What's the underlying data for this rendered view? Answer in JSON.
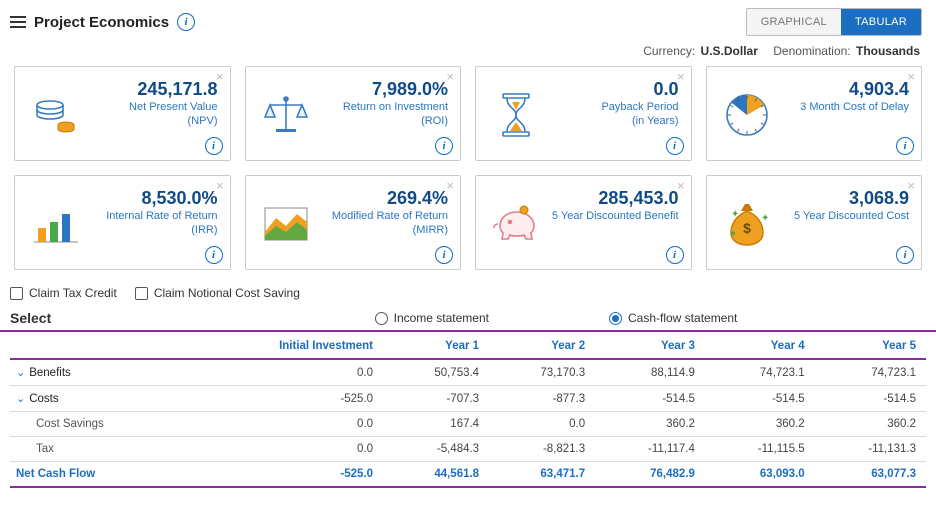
{
  "header": {
    "title": "Project Economics",
    "toggle": {
      "graphical": "GRAPHICAL",
      "tabular": "TABULAR"
    }
  },
  "meta": {
    "currency_label": "Currency:",
    "currency_value": "U.S.Dollar",
    "denomination_label": "Denomination:",
    "denomination_value": "Thousands"
  },
  "cards": [
    {
      "value": "245,171.8",
      "label": "Net Present Value\n(NPV)",
      "icon": "coins-icon"
    },
    {
      "value": "7,989.0%",
      "label": "Return on Investment\n(ROI)",
      "icon": "scales-icon"
    },
    {
      "value": "0.0",
      "label": "Payback Period\n(in Years)",
      "icon": "hourglass-icon"
    },
    {
      "value": "4,903.4",
      "label": "3 Month Cost of Delay",
      "icon": "clock-icon"
    },
    {
      "value": "8,530.0%",
      "label": "Internal Rate of Return\n(IRR)",
      "icon": "bar-chart-icon"
    },
    {
      "value": "269.4%",
      "label": "Modified Rate of Return\n(MIRR)",
      "icon": "area-chart-icon"
    },
    {
      "value": "285,453.0",
      "label": "5 Year Discounted Benefit",
      "icon": "piggy-icon"
    },
    {
      "value": "3,068.9",
      "label": "5 Year Discounted Cost",
      "icon": "money-bag-icon"
    }
  ],
  "options": {
    "claim_tax": "Claim Tax Credit",
    "claim_notional": "Claim Notional Cost Saving"
  },
  "statement": {
    "select_label": "Select",
    "income": "Income statement",
    "cashflow": "Cash-flow statement"
  },
  "table": {
    "headers": [
      "",
      "Initial Investment",
      "Year 1",
      "Year 2",
      "Year 3",
      "Year 4",
      "Year 5"
    ],
    "rows": [
      {
        "kind": "head",
        "label": "Benefits",
        "cells": [
          "0.0",
          "50,753.4",
          "73,170.3",
          "88,114.9",
          "74,723.1",
          "74,723.1"
        ]
      },
      {
        "kind": "head",
        "label": "Costs",
        "cells": [
          "-525.0",
          "-707.3",
          "-877.3",
          "-514.5",
          "-514.5",
          "-514.5"
        ]
      },
      {
        "kind": "sub",
        "label": "Cost Savings",
        "cells": [
          "0.0",
          "167.4",
          "0.0",
          "360.2",
          "360.2",
          "360.2"
        ]
      },
      {
        "kind": "sub",
        "label": "Tax",
        "cells": [
          "0.0",
          "-5,484.3",
          "-8,821.3",
          "-11,117.4",
          "-11,115.5",
          "-11,131.3"
        ]
      },
      {
        "kind": "net",
        "label": "Net Cash Flow",
        "cells": [
          "-525.0",
          "44,561.8",
          "63,471.7",
          "76,482.9",
          "63,093.0",
          "63,077.3"
        ]
      }
    ]
  }
}
